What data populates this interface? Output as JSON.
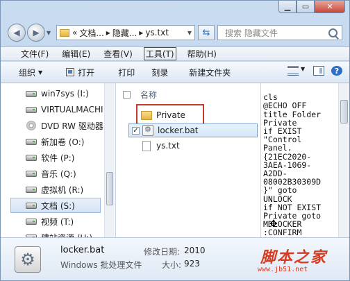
{
  "address": {
    "segments": [
      "«",
      "文档...",
      "▸",
      "隐藏...",
      "▸",
      "ys.txt"
    ]
  },
  "search": {
    "placeholder": "搜索 隐藏文件"
  },
  "menu": [
    "文件(F)",
    "编辑(E)",
    "查看(V)",
    "工具(T)",
    "帮助(H)"
  ],
  "menu_active_index": 3,
  "commands": {
    "organize": "组织",
    "open": "打开",
    "print": "打印",
    "burn": "刻录",
    "new_folder": "新建文件夹"
  },
  "nav": {
    "items": [
      {
        "label": "win7sys (I:)",
        "icon": "drive-icon"
      },
      {
        "label": "VIRTUALMACHI",
        "icon": "drive-icon"
      },
      {
        "label": "DVD RW 驱动器",
        "icon": "disc-icon"
      },
      {
        "label": "新加卷 (O:)",
        "icon": "drive-icon"
      },
      {
        "label": "软件 (P:)",
        "icon": "drive-icon"
      },
      {
        "label": "音乐 (Q:)",
        "icon": "drive-icon"
      },
      {
        "label": "虚拟机 (R:)",
        "icon": "drive-icon"
      },
      {
        "label": "文档 (S:)",
        "icon": "drive-icon",
        "selected": true
      },
      {
        "label": "视频 (T:)",
        "icon": "drive-icon"
      },
      {
        "label": "建站资源 (U:)",
        "icon": "drive-icon"
      }
    ]
  },
  "files": {
    "column_header": "名称",
    "items": [
      {
        "name": "Private",
        "icon": "folder-icon",
        "highlighted": true
      },
      {
        "name": "locker.bat",
        "icon": "bat-icon",
        "selected": true,
        "checked": true
      },
      {
        "name": "ys.txt",
        "icon": "txt-icon"
      }
    ]
  },
  "preview": {
    "lines": [
      "cls",
      "@ECHO OFF",
      "title Folder",
      "Private",
      "if EXIST",
      "\"Control",
      "Panel.",
      "{21EC2020-",
      "3AEA-1069-",
      "A2DD-",
      "08002B30309D",
      "}\" goto",
      "UNLOCK",
      "if NOT EXIST",
      "Private goto",
      "MDLOCKER",
      ":CONFIRM"
    ]
  },
  "details": {
    "name": "locker.bat",
    "type": "Windows 批处理文件",
    "modified_label": "修改日期:",
    "modified_value": "2010",
    "size_label": "大小:",
    "size_value": "923"
  },
  "watermark": {
    "text": "脚本之家",
    "url": "www.jb51.net"
  },
  "colors": {
    "accent": "#c0392b",
    "selection": "#d5e6f8",
    "watermark": "#d83a1f"
  }
}
